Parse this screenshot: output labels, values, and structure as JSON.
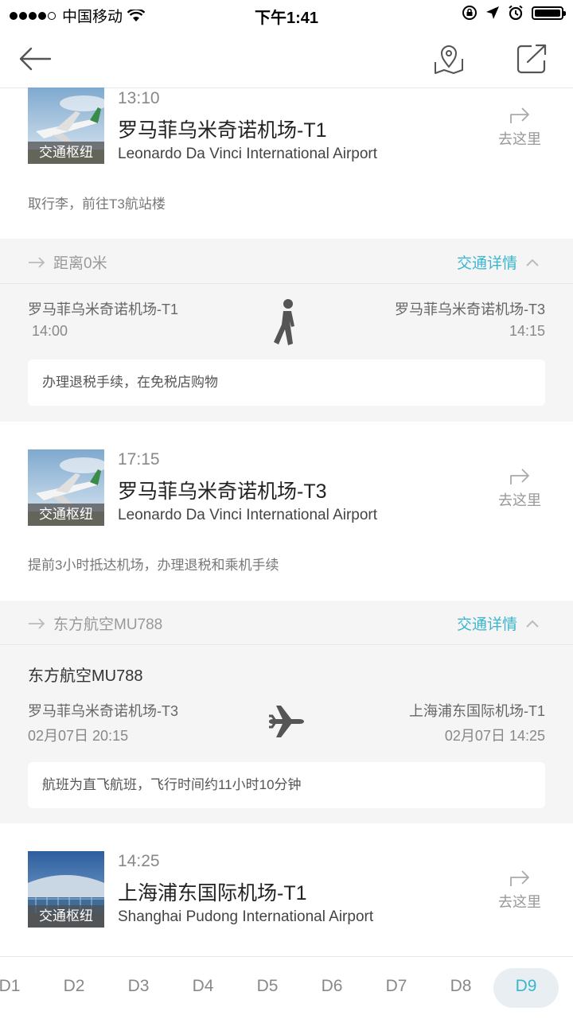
{
  "status_bar": {
    "carrier": "中国移动",
    "time": "下午1:41"
  },
  "nav": {
    "back_icon": "arrow-left-icon",
    "map_icon": "map-pin-icon",
    "share_icon": "share-icon"
  },
  "stops": [
    {
      "time": "13:10",
      "name": "罗马菲乌米奇诺机场-T1",
      "en_name": "Leonardo Da Vinci International Airport",
      "tag": "交通枢纽",
      "goto": "去这里",
      "note": "取行李，前往T3航站楼"
    },
    {
      "time": "17:15",
      "name": "罗马菲乌米奇诺机场-T3",
      "en_name": "Leonardo Da Vinci International Airport",
      "tag": "交通枢纽",
      "goto": "去这里",
      "note": "提前3小时抵达机场，办理退税和乘机手续"
    },
    {
      "time": "14:25",
      "name": "上海浦东国际机场-T1",
      "en_name": "Shanghai Pudong International Airport",
      "tag": "交通枢纽",
      "goto": "去这里"
    }
  ],
  "segments": [
    {
      "summary": "距离0米",
      "details_label": "交通详情",
      "from_station": "罗马菲乌米奇诺机场-T1",
      "from_time": "14:00",
      "to_station": "罗马菲乌米奇诺机场-T3",
      "to_time": "14:15",
      "mode_icon": "walking-icon",
      "note": "办理退税手续，在免税店购物"
    },
    {
      "summary": "东方航空MU788",
      "details_label": "交通详情",
      "flight": "东方航空MU788",
      "from_station": "罗马菲乌米奇诺机场-T3",
      "from_time": "02月07日 20:15",
      "to_station": "上海浦东国际机场-T1",
      "to_time": "02月07日 14:25",
      "mode_icon": "airplane-icon",
      "note": "航班为直飞航班，飞行时间约11小时10分钟"
    }
  ],
  "day_tabs": {
    "items": [
      "D1",
      "D2",
      "D3",
      "D4",
      "D5",
      "D6",
      "D7",
      "D8",
      "D9"
    ],
    "active": "D9"
  },
  "colors": {
    "accent": "#3ab7cf",
    "band": "#f5f5f5"
  }
}
